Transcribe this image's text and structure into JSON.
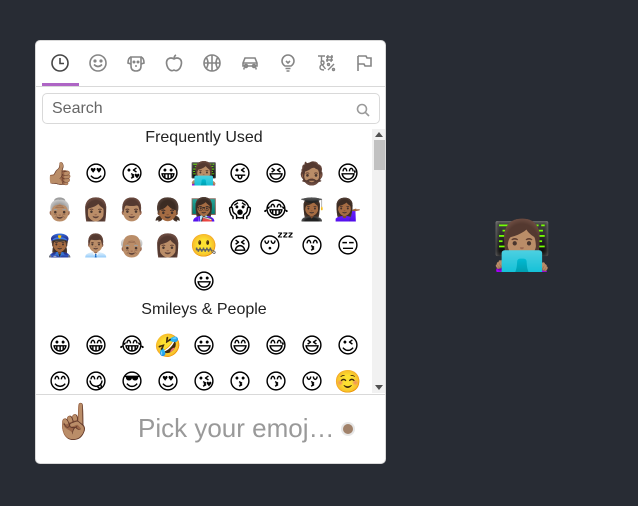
{
  "search": {
    "placeholder": "Search",
    "value": ""
  },
  "categories": [
    {
      "name": "recent",
      "icon": "clock-icon",
      "active": true
    },
    {
      "name": "smileys",
      "icon": "smiley-icon"
    },
    {
      "name": "animals",
      "icon": "dog-icon"
    },
    {
      "name": "food",
      "icon": "apple-icon"
    },
    {
      "name": "activity",
      "icon": "basketball-icon"
    },
    {
      "name": "travel",
      "icon": "car-icon"
    },
    {
      "name": "objects",
      "icon": "lightbulb-icon"
    },
    {
      "name": "symbols",
      "icon": "symbols-icon"
    },
    {
      "name": "flags",
      "icon": "flag-icon"
    }
  ],
  "sections": [
    {
      "label": "Frequently Used",
      "emojis": [
        "👍🏽",
        "😍",
        "😘",
        "😀",
        "👩🏽‍💻",
        "😜",
        "😆",
        "🧔🏽",
        "😅",
        "👵🏽",
        "👩🏽",
        "👨🏽",
        "👧🏾",
        "👩🏾‍🏫",
        "😱",
        "😂",
        "👩🏾‍🎓",
        "💁🏾‍♀️",
        "👮🏾‍♀️",
        "👨🏽‍💼",
        "👴🏽",
        "👩🏽",
        "🤐",
        "😫",
        "😴",
        "😙",
        "😑",
        "😃"
      ]
    },
    {
      "label": "Smileys & People",
      "emojis": [
        "😀",
        "😁",
        "😂",
        "🤣",
        "😃",
        "😄",
        "😅",
        "😆",
        "😉",
        "😊",
        "😋",
        "😎",
        "😍",
        "😘",
        "😗",
        "😙",
        "😚",
        "☺️"
      ]
    }
  ],
  "preview": {
    "emoji": "☝🏽",
    "title": "Pick your emoji…",
    "skin_tone_color": "#a1826a"
  },
  "selected_emoji": "👩🏽‍💻",
  "colors": {
    "accent": "#ae65c5",
    "background": "#282c34"
  }
}
